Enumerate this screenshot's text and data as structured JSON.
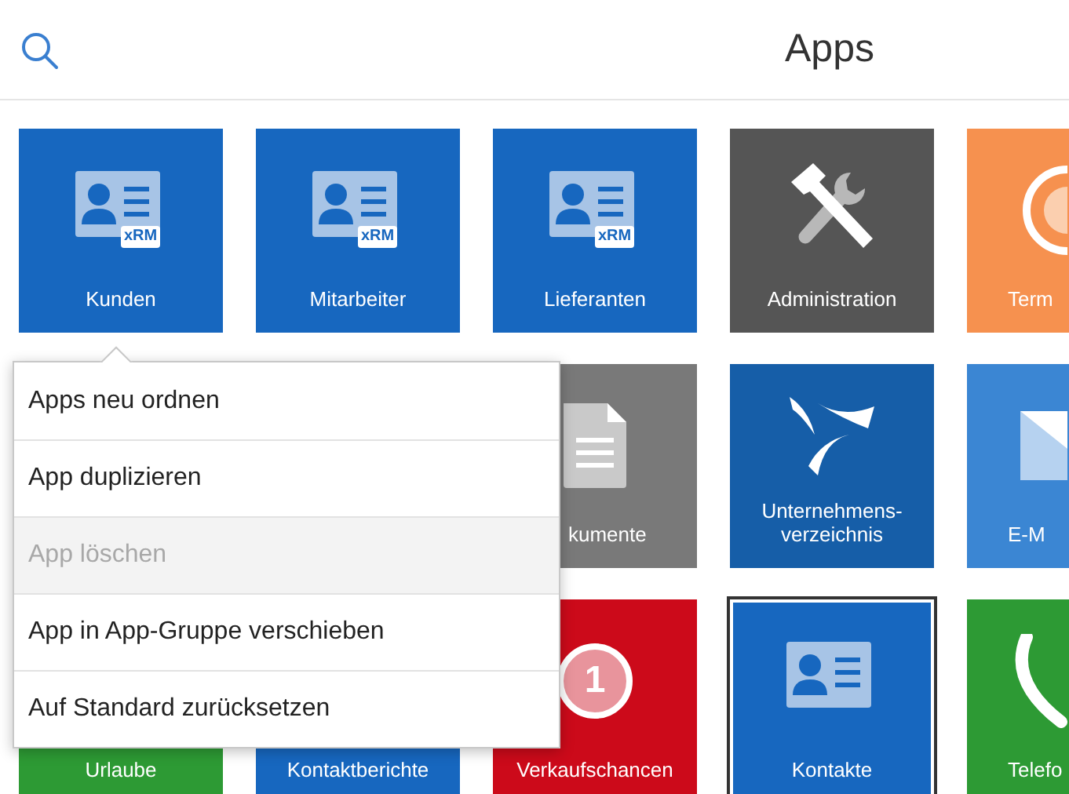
{
  "header": {
    "title": "Apps"
  },
  "tiles": [
    [
      {
        "label": "Kunden",
        "kind": "contact-xrm",
        "badge": "xRM",
        "color": "#1767bf",
        "selected": false
      },
      {
        "label": "Mitarbeiter",
        "kind": "contact-xrm",
        "badge": "xRM",
        "color": "#1767bf",
        "selected": false
      },
      {
        "label": "Lieferanten",
        "kind": "contact-xrm",
        "badge": "xRM",
        "color": "#1767bf",
        "selected": false
      },
      {
        "label": "Administration",
        "kind": "tools",
        "color": "#555555",
        "selected": false
      },
      {
        "label": "Term",
        "kind": "target",
        "color": "#f6914f",
        "selected": false
      }
    ],
    [
      {
        "kind": "hidden"
      },
      {
        "kind": "hidden"
      },
      {
        "label": "kumente",
        "kind": "document",
        "color": "#797979",
        "selected": false
      },
      {
        "label": "Unternehmens-\nverzeichnis",
        "kind": "logo",
        "color": "#165ea8",
        "selected": false
      },
      {
        "label": "E-M",
        "kind": "mail",
        "color": "#3b86d3",
        "selected": false
      }
    ],
    [
      {
        "label": "Urlaube",
        "kind": "blank",
        "color": "#2d9a34",
        "selected": false
      },
      {
        "label": "Kontaktberichte",
        "kind": "blank",
        "color": "#1767bf",
        "selected": false
      },
      {
        "label": "Verkaufschancen",
        "kind": "badge",
        "badge": "1",
        "color": "#cc0a1a",
        "selected": false
      },
      {
        "label": "Kontakte",
        "kind": "contact",
        "color": "#1767bf",
        "selected": true
      },
      {
        "label": "Telefo",
        "kind": "phone",
        "color": "#2d9a34",
        "selected": false
      }
    ]
  ],
  "context_menu": [
    {
      "label": "Apps neu ordnen",
      "disabled": false
    },
    {
      "label": "App duplizieren",
      "disabled": false
    },
    {
      "label": "App löschen",
      "disabled": true
    },
    {
      "label": "App in App-Gruppe verschieben",
      "disabled": false
    },
    {
      "label": "Auf Standard zurücksetzen",
      "disabled": false
    }
  ]
}
